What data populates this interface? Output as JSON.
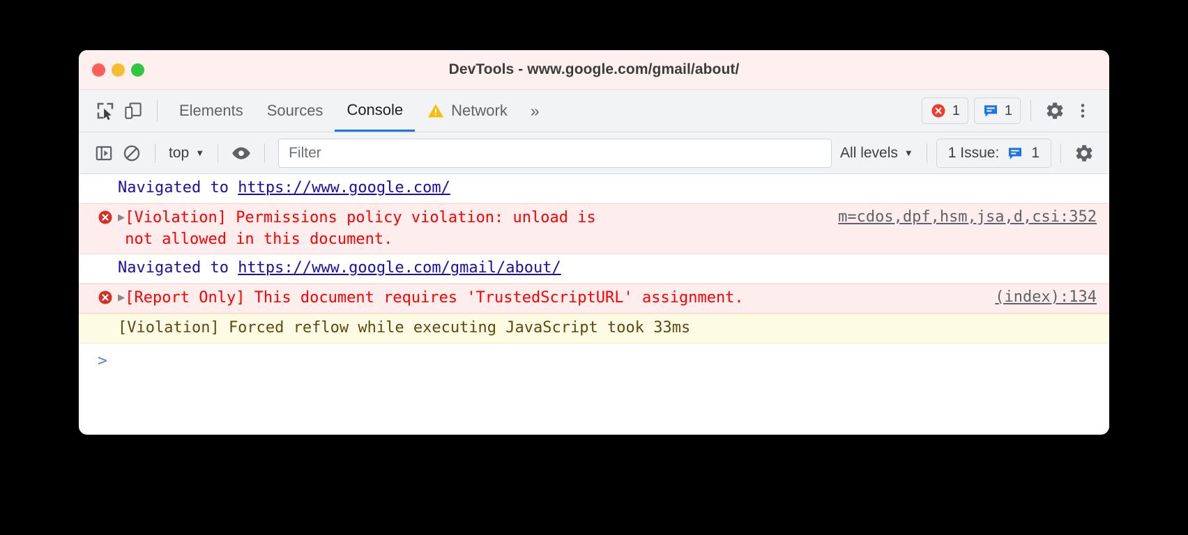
{
  "window": {
    "title": "DevTools - www.google.com/gmail/about/",
    "traffic_lights": [
      "close",
      "minimize",
      "maximize"
    ],
    "colors": {
      "titlebar_bg": "#fdf0ee",
      "toolbar_bg": "#f1f3f4",
      "accent_blue": "#1a73e8",
      "error_red": "#ff0000",
      "error_row_bg": "#fdeded",
      "warning_row_bg": "#fefbe5",
      "link_blue": "#1a0dab"
    }
  },
  "tab_bar": {
    "inspect_icon": "inspect-cursor-icon",
    "device_icon": "device-toolbar-icon",
    "tabs": [
      {
        "label": "Elements",
        "selected": false,
        "icon": null
      },
      {
        "label": "Sources",
        "selected": false,
        "icon": null
      },
      {
        "label": "Console",
        "selected": true,
        "icon": null
      },
      {
        "label": "Network",
        "selected": false,
        "icon": "warning-triangle-icon"
      }
    ],
    "more_tabs": "»",
    "error_count": "1",
    "issues_count": "1",
    "settings_icon": "gear-icon",
    "menu_icon": "more-vertical-icon"
  },
  "console_toolbar": {
    "sidebar_toggle_icon": "console-sidebar-icon",
    "clear_icon": "clear-console-icon",
    "context": "top",
    "eye_icon": "live-expression-icon",
    "filter_placeholder": "Filter",
    "filter_value": "",
    "levels": "All levels",
    "issues_label": "1 Issue:",
    "issues_count": "1",
    "settings_icon": "gear-icon"
  },
  "console_log": {
    "rows": [
      {
        "kind": "info",
        "prefix": "Navigated to ",
        "link": "https://www.google.com/",
        "source": "",
        "expandable": false
      },
      {
        "kind": "error",
        "prefix": "[Violation] Permissions policy violation: unload is\nnot allowed in this document.",
        "link": "",
        "source": "m=cdos,dpf,hsm,jsa,d,csi:352",
        "expandable": true
      },
      {
        "kind": "info",
        "prefix": "Navigated to ",
        "link": "https://www.google.com/gmail/about/",
        "source": "",
        "expandable": false
      },
      {
        "kind": "error",
        "prefix": "[Report Only] This document requires 'TrustedScriptURL' assignment.",
        "link": "",
        "source": "(index):134",
        "expandable": true
      },
      {
        "kind": "warning",
        "prefix": "[Violation] Forced reflow while executing JavaScript took 33ms",
        "link": "",
        "source": "",
        "expandable": false
      }
    ],
    "prompt_symbol": ">"
  }
}
